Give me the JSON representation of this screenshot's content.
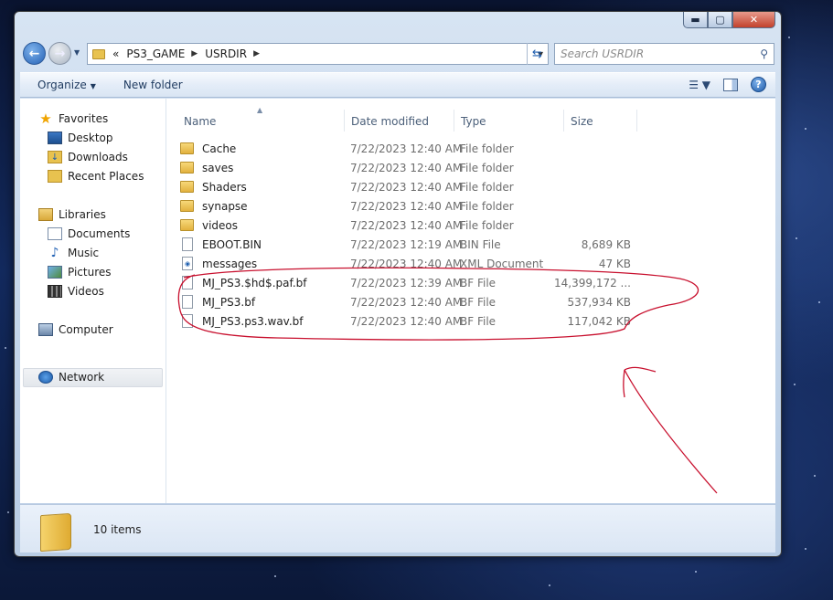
{
  "window": {
    "minimize_label": "▬",
    "maximize_label": "▢",
    "close_label": "✕"
  },
  "address_bar": {
    "overflow": "«",
    "crumbs": [
      "PS3_GAME",
      "USRDIR"
    ]
  },
  "search": {
    "placeholder": "Search USRDIR"
  },
  "toolbar": {
    "organize_label": "Organize",
    "new_folder_label": "New folder"
  },
  "sidebar": {
    "favorites": "Favorites",
    "favorites_items": [
      "Desktop",
      "Downloads",
      "Recent Places"
    ],
    "libraries": "Libraries",
    "libraries_items": [
      "Documents",
      "Music",
      "Pictures",
      "Videos"
    ],
    "computer": "Computer",
    "network": "Network"
  },
  "columns": {
    "name": "Name",
    "date": "Date modified",
    "type": "Type",
    "size": "Size"
  },
  "files": [
    {
      "name": "Cache",
      "date": "7/22/2023 12:40 AM",
      "type": "File folder",
      "size": "",
      "kind": "folder"
    },
    {
      "name": "saves",
      "date": "7/22/2023 12:40 AM",
      "type": "File folder",
      "size": "",
      "kind": "folder"
    },
    {
      "name": "Shaders",
      "date": "7/22/2023 12:40 AM",
      "type": "File folder",
      "size": "",
      "kind": "folder"
    },
    {
      "name": "synapse",
      "date": "7/22/2023 12:40 AM",
      "type": "File folder",
      "size": "",
      "kind": "folder"
    },
    {
      "name": "videos",
      "date": "7/22/2023 12:40 AM",
      "type": "File folder",
      "size": "",
      "kind": "folder"
    },
    {
      "name": "EBOOT.BIN",
      "date": "7/22/2023 12:19 AM",
      "type": "BIN File",
      "size": "8,689 KB",
      "kind": "file"
    },
    {
      "name": "messages",
      "date": "7/22/2023 12:40 AM",
      "type": "XML Document",
      "size": "47 KB",
      "kind": "xml"
    },
    {
      "name": "MJ_PS3.$hd$.paf.bf",
      "date": "7/22/2023 12:39 AM",
      "type": "BF File",
      "size": "14,399,172 ...",
      "kind": "file"
    },
    {
      "name": "MJ_PS3.bf",
      "date": "7/22/2023 12:40 AM",
      "type": "BF File",
      "size": "537,934 KB",
      "kind": "file"
    },
    {
      "name": "MJ_PS3.ps3.wav.bf",
      "date": "7/22/2023 12:40 AM",
      "type": "BF File",
      "size": "117,042 KB",
      "kind": "file"
    }
  ],
  "status": {
    "item_count": "10 items"
  },
  "colors": {
    "annotation_red": "#c8102e",
    "accent_blue": "#1f5fb0"
  }
}
